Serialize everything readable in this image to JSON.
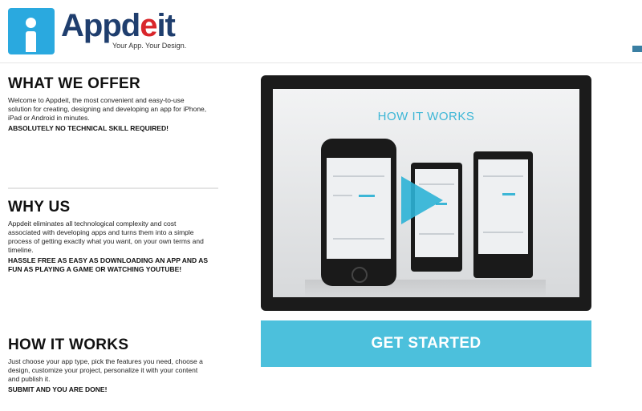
{
  "brand": {
    "name_main": "Appd",
    "name_accent": "e",
    "name_tail": "it",
    "tagline": "Your App. Your Design."
  },
  "sections": [
    {
      "title": "WHAT WE OFFER",
      "body": "Welcome to Appdeit, the most convenient and easy-to-use solution for creating, designing and developing an app for iPhone, iPad or Android in minutes.",
      "caps": "ABSOLUTELY NO TECHNICAL SKILL REQUIRED!"
    },
    {
      "title": "WHY US",
      "body": "Appdeit eliminates all technological complexity and cost associated with developing apps and turns them into a simple process of getting exactly what you want, on your own terms and timeline.",
      "caps": "HASSLE FREE AS EASY AS DOWNLOADING AN APP AND AS FUN AS PLAYING A GAME OR WATCHING YOUTUBE!"
    },
    {
      "title": "HOW IT WORKS",
      "body": "Just choose your app type, pick the features you need, choose a design, customize your project, personalize it with your content and publish it.",
      "caps": "SUBMIT AND YOU ARE DONE!"
    }
  ],
  "video": {
    "title": "HOW IT WORKS"
  },
  "cta": {
    "label": "GET STARTED"
  },
  "colors": {
    "accent": "#4cc0dc",
    "brand_blue": "#1f3e6e",
    "brand_red": "#d9262b"
  }
}
